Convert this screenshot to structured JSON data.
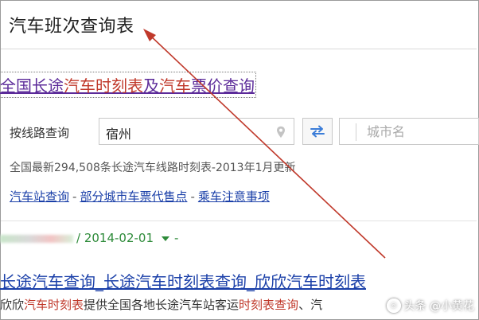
{
  "search": {
    "query": "汽车班次查询表"
  },
  "result1": {
    "title_parts": [
      "全国长途",
      "汽车时刻表",
      "及",
      "汽车",
      "票价查询"
    ]
  },
  "route_search": {
    "label": "按线路查询",
    "from_value": "宿州",
    "to_placeholder": "城市名"
  },
  "stats_text": "全国最新294,508条长途汽车线路时刻表-2013年1月更新",
  "links": {
    "station_query": "汽车站查询",
    "sep": "-",
    "ticket_agency": "部分城市车票代售点",
    "notice": "乘车注意事项"
  },
  "result2": {
    "url_date": "/ 2014-02-01",
    "url_tail": "-",
    "title": "长途汽车查询_长途汽车时刻表查询_欣欣汽车时刻表",
    "snippet_parts": [
      "欣欣",
      "汽车时刻表",
      "提供全国各地长途汽车站客运",
      "时刻表查询",
      "、汽"
    ]
  },
  "watermark": {
    "text": "头条 @小黄花",
    "icon_text": "◎"
  },
  "colors": {
    "visited_link": "#5b2a99",
    "link": "#1a3fa8",
    "highlight": "#c0392b",
    "url_green": "#2e8b3a",
    "arrow": "#c0392b"
  }
}
